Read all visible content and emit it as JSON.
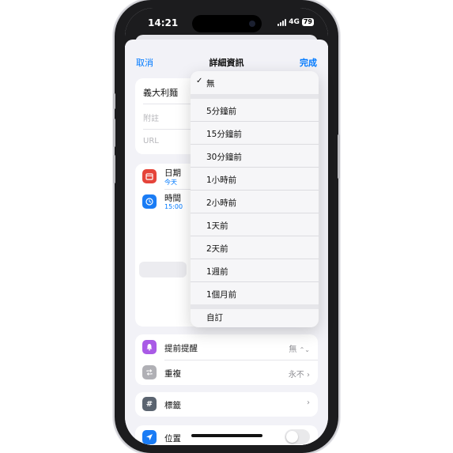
{
  "status": {
    "time": "14:21",
    "network": "4G",
    "battery": "79"
  },
  "nav": {
    "cancel": "取消",
    "title": "詳細資訊",
    "done": "完成"
  },
  "details": {
    "title_value": "義大利麵",
    "notes_placeholder": "附註",
    "url_placeholder": "URL"
  },
  "date_time": {
    "date_label": "日期",
    "date_value": "今天",
    "time_label": "時間",
    "time_value": "15:00"
  },
  "dropdown": {
    "selected": "無",
    "items": [
      "5分鐘前",
      "15分鐘前",
      "30分鐘前",
      "1小時前",
      "2小時前",
      "1天前",
      "2天前",
      "1週前",
      "1個月前"
    ],
    "custom": "自訂"
  },
  "early_reminder": {
    "label": "提前提醒",
    "value": "無"
  },
  "repeat": {
    "label": "重複",
    "value": "永不"
  },
  "tags": {
    "label": "標籤"
  },
  "location": {
    "label": "位置"
  },
  "colors": {
    "accent": "#007aff",
    "date_icon": "#e5443a",
    "time_icon": "#1a7cf5",
    "bell_icon": "#a95ae6",
    "repeat_icon": "#b0b0b5",
    "tag_icon": "#5b6470",
    "location_icon": "#1a7cf5"
  },
  "icons": {
    "date": "calendar-icon",
    "time": "clock-icon",
    "early": "bell-icon",
    "repeat": "repeat-icon",
    "tags": "hash-icon",
    "location": "location-arrow-icon",
    "checkmark": "checkmark-icon",
    "chevron": "chevron-right-icon",
    "updown": "chevron-updown-icon"
  }
}
